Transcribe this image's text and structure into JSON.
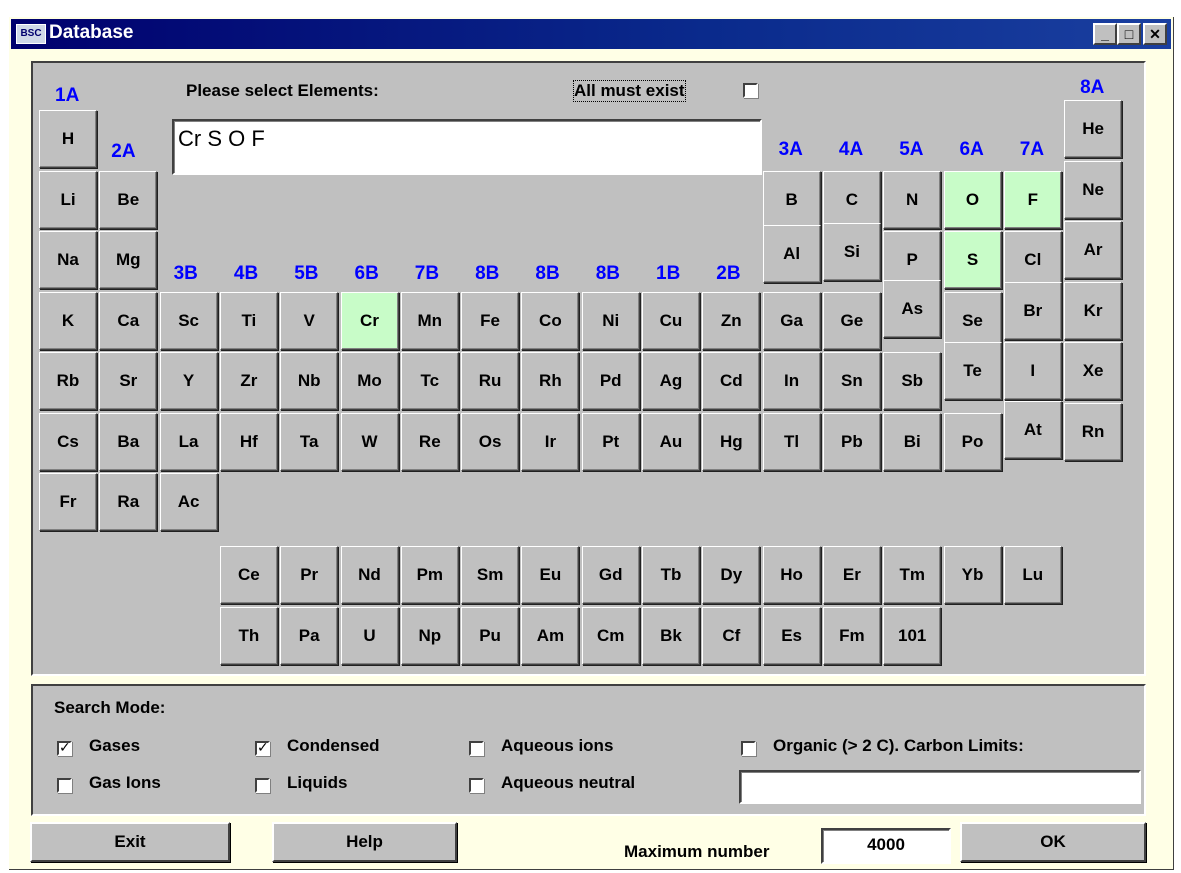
{
  "window": {
    "title": "Database",
    "icon_text": "BSC",
    "min": "_",
    "max": "□",
    "close": "✕"
  },
  "selection": {
    "prompt": "Please select Elements:",
    "value": "Cr S O F",
    "all_must_exist_label": "All must exist",
    "all_must_exist_checked": false
  },
  "groups": [
    "1A",
    "2A",
    "3B",
    "4B",
    "5B",
    "6B",
    "7B",
    "8B",
    "8B",
    "8B",
    "1B",
    "2B",
    "3A",
    "4A",
    "5A",
    "6A",
    "7A",
    "8A"
  ],
  "rows": [
    [
      "H",
      "",
      "",
      "",
      "",
      "",
      "",
      "",
      "",
      "",
      "",
      "",
      "",
      "",
      "",
      "",
      "",
      "He"
    ],
    [
      "Li",
      "Be",
      "",
      "",
      "",
      "",
      "",
      "",
      "",
      "",
      "",
      "",
      "B",
      "C",
      "N",
      "O",
      "F",
      "Ne"
    ],
    [
      "Na",
      "Mg",
      "",
      "",
      "",
      "",
      "",
      "",
      "",
      "",
      "",
      "",
      "Al",
      "Si",
      "P",
      "S",
      "Cl",
      "Ar"
    ],
    [
      "K",
      "Ca",
      "Sc",
      "Ti",
      "V",
      "Cr",
      "Mn",
      "Fe",
      "Co",
      "Ni",
      "Cu",
      "Zn",
      "Ga",
      "Ge",
      "As",
      "Se",
      "Br",
      "Kr"
    ],
    [
      "Rb",
      "Sr",
      "Y",
      "Zr",
      "Nb",
      "Mo",
      "Tc",
      "Ru",
      "Rh",
      "Pd",
      "Ag",
      "Cd",
      "In",
      "Sn",
      "Sb",
      "Te",
      "I",
      "Xe"
    ],
    [
      "Cs",
      "Ba",
      "La",
      "Hf",
      "Ta",
      "W",
      "Re",
      "Os",
      "Ir",
      "Pt",
      "Au",
      "Hg",
      "Tl",
      "Pb",
      "Bi",
      "Po",
      "At",
      "Rn"
    ],
    [
      "Fr",
      "Ra",
      "Ac",
      "",
      "",
      "",
      "",
      "",
      "",
      "",
      "",
      "",
      "",
      "",
      "",
      "",
      "",
      ""
    ]
  ],
  "lanthanides": [
    "Ce",
    "Pr",
    "Nd",
    "Pm",
    "Sm",
    "Eu",
    "Gd",
    "Tb",
    "Dy",
    "Ho",
    "Er",
    "Tm",
    "Yb",
    "Lu"
  ],
  "actinides": [
    "Th",
    "Pa",
    "U",
    "Np",
    "Pu",
    "Am",
    "Cm",
    "Bk",
    "Cf",
    "Es",
    "Fm",
    "101"
  ],
  "selected_elements": [
    "Cr",
    "S",
    "O",
    "F"
  ],
  "search_mode": {
    "title": "Search Mode:",
    "gases": {
      "label": "Gases",
      "checked": true
    },
    "gas_ions": {
      "label": "Gas Ions",
      "checked": false
    },
    "condensed": {
      "label": "Condensed",
      "checked": true
    },
    "liquids": {
      "label": "Liquids",
      "checked": false
    },
    "aqueous_ions": {
      "label": "Aqueous ions",
      "checked": false
    },
    "aqueous_neutral": {
      "label": "Aqueous neutral",
      "checked": false
    },
    "organic": {
      "label": "Organic (> 2 C). Carbon Limits:",
      "checked": false
    },
    "carbon_limits_value": ""
  },
  "footer": {
    "exit_label": "Exit",
    "help_label": "Help",
    "max_number_label": "Maximum number",
    "max_number_value": "4000",
    "ok_label": "OK"
  },
  "colors": {
    "selected_bg": "#c8fcc8",
    "group_label": "#0000ff",
    "title_bar": "#00006e",
    "window_bg": "#ffffe6"
  }
}
